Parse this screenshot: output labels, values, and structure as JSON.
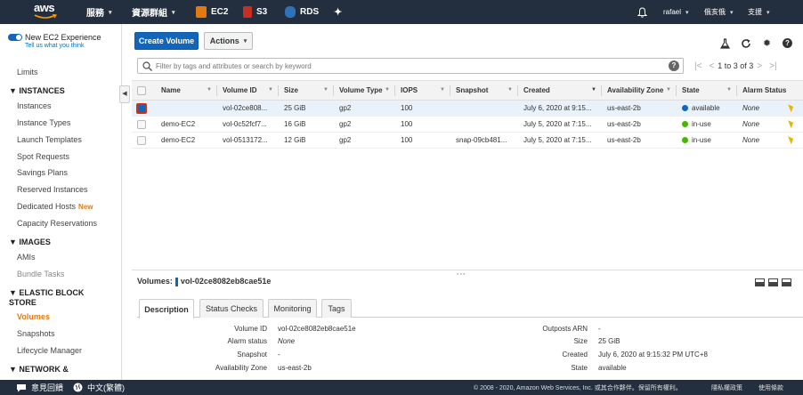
{
  "topbar": {
    "logo_text": "aws",
    "services_label": "服務",
    "resource_groups_label": "資源群組",
    "pinned": [
      {
        "label": "EC2",
        "icon": "ec2-icon",
        "color": "#e47911"
      },
      {
        "label": "S3",
        "icon": "s3-icon",
        "color": "#c7301f"
      },
      {
        "label": "RDS",
        "icon": "rds-icon",
        "color": "#2e73b8"
      }
    ],
    "user_label": "rafael",
    "region_label": "俄亥俄",
    "support_label": "支援"
  },
  "sidebar": {
    "experience_title": "New EC2 Experience",
    "experience_link": "Tell us what you think",
    "items": [
      {
        "label": "Limits",
        "type": "item"
      },
      {
        "label": "INSTANCES",
        "type": "section"
      },
      {
        "label": "Instances",
        "type": "item"
      },
      {
        "label": "Instance Types",
        "type": "item"
      },
      {
        "label": "Launch Templates",
        "type": "item"
      },
      {
        "label": "Spot Requests",
        "type": "item"
      },
      {
        "label": "Savings Plans",
        "type": "item"
      },
      {
        "label": "Reserved Instances",
        "type": "item"
      },
      {
        "label": "Dedicated Hosts",
        "type": "item",
        "badge": "New"
      },
      {
        "label": "Capacity Reservations",
        "type": "item"
      },
      {
        "label": "IMAGES",
        "type": "section"
      },
      {
        "label": "AMIs",
        "type": "item"
      },
      {
        "label": "Bundle Tasks",
        "type": "item"
      },
      {
        "label": "ELASTIC BLOCK STORE",
        "type": "section"
      },
      {
        "label": "Volumes",
        "type": "item",
        "active": true
      },
      {
        "label": "Snapshots",
        "type": "item"
      },
      {
        "label": "Lifecycle Manager",
        "type": "item"
      },
      {
        "label": "NETWORK &",
        "type": "section"
      }
    ]
  },
  "toolbar": {
    "create_label": "Create Volume",
    "actions_label": "Actions"
  },
  "search": {
    "placeholder": "Filter by tags and attributes or search by keyword",
    "pager_text": "1 to 3 of 3"
  },
  "table": {
    "columns": [
      "Name",
      "Volume ID",
      "Size",
      "Volume Type",
      "IOPS",
      "Snapshot",
      "Created",
      "Availability Zone",
      "State",
      "Alarm Status"
    ],
    "rows": [
      {
        "name": "",
        "volume_id": "vol-02ce808...",
        "size": "25 GiB",
        "type": "gp2",
        "iops": "100",
        "snapshot": "",
        "created": "July 6, 2020 at 9:15...",
        "az": "us-east-2b",
        "state": "available",
        "state_color": "#1166bb",
        "alarm": "None",
        "selected": true
      },
      {
        "name": "demo-EC2",
        "volume_id": "vol-0c52fcf7...",
        "size": "16 GiB",
        "type": "gp2",
        "iops": "100",
        "snapshot": "",
        "created": "July 5, 2020 at 7:15...",
        "az": "us-east-2b",
        "state": "in-use",
        "state_color": "#44b700",
        "alarm": "None",
        "selected": false
      },
      {
        "name": "demo-EC2",
        "volume_id": "vol-0513172...",
        "size": "12 GiB",
        "type": "gp2",
        "iops": "100",
        "snapshot": "snap-09cb481...",
        "created": "July 5, 2020 at 7:15...",
        "az": "us-east-2b",
        "state": "in-use",
        "state_color": "#44b700",
        "alarm": "None",
        "selected": false
      }
    ]
  },
  "details": {
    "prefix": "Volumes:",
    "volume_id": "vol-02ce8082eb8cae51e",
    "tabs": [
      "Description",
      "Status Checks",
      "Monitoring",
      "Tags"
    ],
    "left": [
      {
        "label": "Volume ID",
        "value": "vol-02ce8082eb8cae51e"
      },
      {
        "label": "Alarm status",
        "value": "None"
      },
      {
        "label": "Snapshot",
        "value": "-"
      },
      {
        "label": "Availability Zone",
        "value": "us-east-2b"
      }
    ],
    "right": [
      {
        "label": "Outposts ARN",
        "value": "-"
      },
      {
        "label": "Size",
        "value": "25 GiB"
      },
      {
        "label": "Created",
        "value": "July 6, 2020 at 9:15:32 PM UTC+8"
      },
      {
        "label": "State",
        "value": "available"
      }
    ]
  },
  "footer": {
    "feedback": "意見回饋",
    "language": "中文(繁體)",
    "copyright": "© 2008 - 2020, Amazon Web Services, Inc. 或其合作夥伴。保留所有權利。",
    "privacy": "隱私權政策",
    "terms": "使用條款"
  }
}
